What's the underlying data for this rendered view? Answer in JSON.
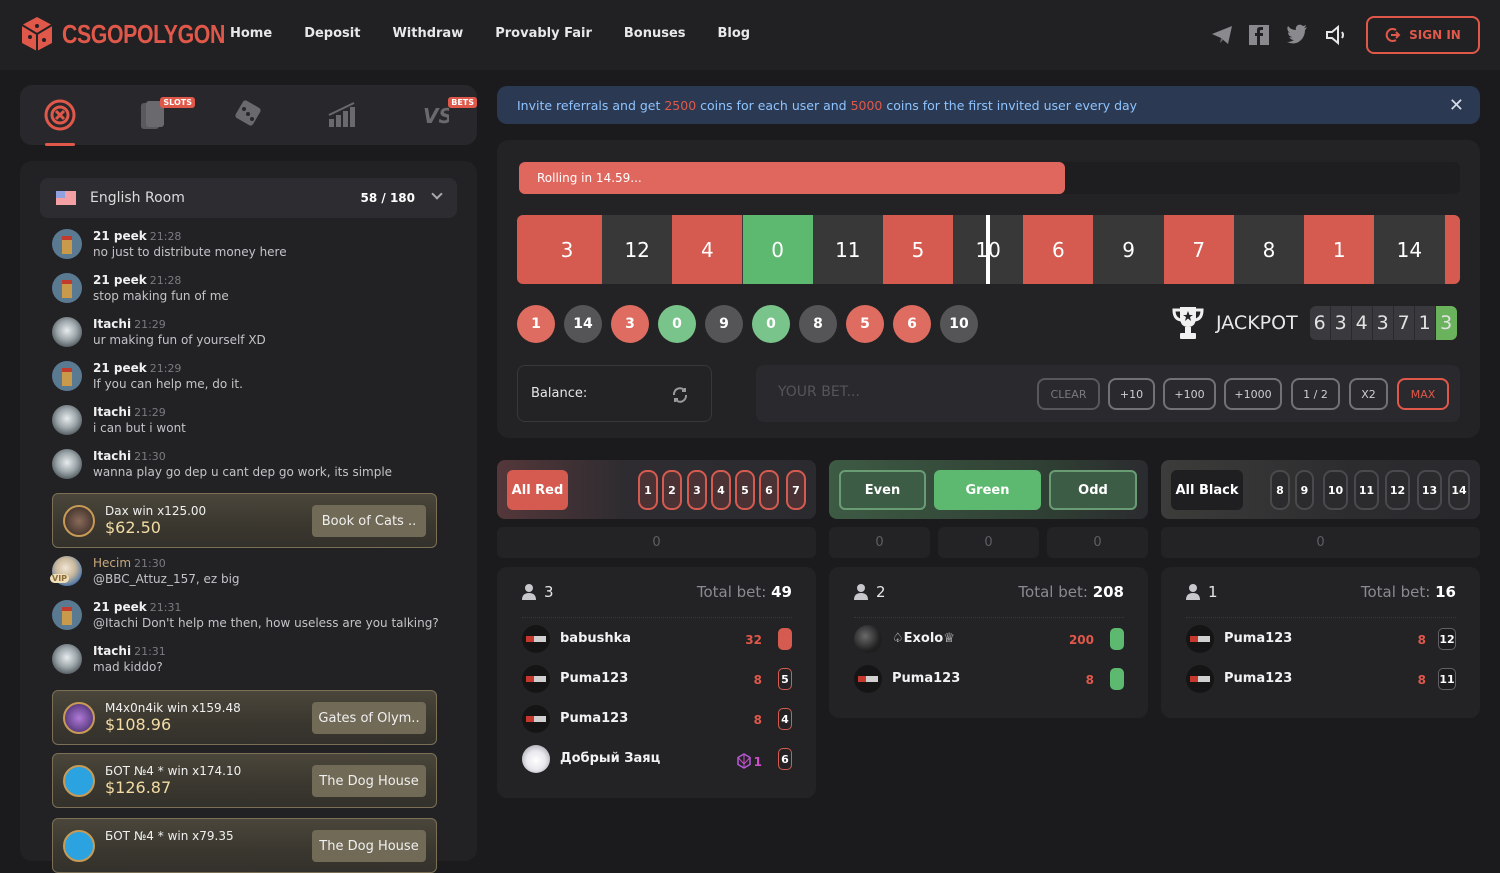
{
  "header": {
    "logo_text": "CSGOPOLYGON",
    "brand_color": "#e0584a",
    "nav": [
      "Home",
      "Deposit",
      "Withdraw",
      "Provably Fair",
      "Bonuses",
      "Blog"
    ],
    "social_icons": [
      "telegram-icon",
      "facebook-icon",
      "twitter-icon",
      "sound-icon"
    ],
    "signin_label": "SIGN IN"
  },
  "game_tabs": [
    {
      "name": "roulette",
      "icon": "roulette-icon",
      "active": true
    },
    {
      "name": "slots",
      "icon": "cards-icon",
      "badge": "SLOTS"
    },
    {
      "name": "dice",
      "icon": "dice-icon"
    },
    {
      "name": "crash",
      "icon": "chart-icon"
    },
    {
      "name": "versus",
      "icon": "vs-icon",
      "badge": "BETS"
    }
  ],
  "chat": {
    "room": "English Room",
    "online": "58 / 180",
    "items": [
      {
        "type": "msg",
        "user": "21 peek",
        "time": "21:28",
        "text": "no just to distribute money here",
        "avatar": "peek"
      },
      {
        "type": "msg",
        "user": "21 peek",
        "time": "21:28",
        "text": "stop making fun of me",
        "avatar": "peek"
      },
      {
        "type": "msg",
        "user": "Itachi",
        "time": "21:29",
        "text": "ur making fun of yourself XD",
        "avatar": "itachi"
      },
      {
        "type": "msg",
        "user": "21 peek",
        "time": "21:29",
        "text": "If you can help me, do it.",
        "avatar": "peek"
      },
      {
        "type": "msg",
        "user": "Itachi",
        "time": "21:29",
        "text": "i can but i wont",
        "avatar": "itachi"
      },
      {
        "type": "msg",
        "user": "Itachi",
        "time": "21:30",
        "text": "wanna play go dep u cant dep go work, its simple",
        "avatar": "itachi"
      },
      {
        "type": "win",
        "line1": "Dax win x125.00",
        "amount": "$62.50",
        "game": "Book of Cats .."
      },
      {
        "type": "msg",
        "user": "Hecim",
        "time": "21:30",
        "text": "@BBC_Attuz_157, ez big",
        "avatar": "hecim",
        "vip": "VIP"
      },
      {
        "type": "msg",
        "user": "21 peek",
        "time": "21:31",
        "text": "@Itachi Don't help me then, how useless are you talking?",
        "avatar": "peek"
      },
      {
        "type": "msg",
        "user": "Itachi",
        "time": "21:31",
        "text": "mad kiddo?",
        "avatar": "itachi"
      },
      {
        "type": "win",
        "line1": "M4x0n4ik win x159.48",
        "amount": "$108.96",
        "game": "Gates of Olym.."
      },
      {
        "type": "win",
        "line1": "БОТ №4 * win x174.10",
        "amount": "$126.87",
        "game": "The Dog House"
      },
      {
        "type": "win",
        "line1": "БОТ №4 * win x79.35",
        "amount": "",
        "game": "The Dog House"
      }
    ]
  },
  "banner": {
    "parts": [
      "Invite referrals and get ",
      "2500",
      " coins for each user and ",
      "5000",
      " coins for the first invited user every day"
    ]
  },
  "roulette": {
    "rolling_text": "Rolling in 14.59...",
    "rolling_progress": 0.58,
    "strip": [
      {
        "n": "3",
        "c": "red"
      },
      {
        "n": "12",
        "c": "black"
      },
      {
        "n": "4",
        "c": "red"
      },
      {
        "n": "0",
        "c": "green"
      },
      {
        "n": "11",
        "c": "black"
      },
      {
        "n": "5",
        "c": "red"
      },
      {
        "n": "10",
        "c": "black"
      },
      {
        "n": "6",
        "c": "red"
      },
      {
        "n": "9",
        "c": "black"
      },
      {
        "n": "7",
        "c": "red"
      },
      {
        "n": "8",
        "c": "black"
      },
      {
        "n": "1",
        "c": "red"
      },
      {
        "n": "14",
        "c": "black"
      }
    ],
    "history": [
      {
        "n": "1",
        "c": "red"
      },
      {
        "n": "14",
        "c": "black"
      },
      {
        "n": "3",
        "c": "red"
      },
      {
        "n": "0",
        "c": "green"
      },
      {
        "n": "9",
        "c": "black"
      },
      {
        "n": "0",
        "c": "green"
      },
      {
        "n": "8",
        "c": "black"
      },
      {
        "n": "5",
        "c": "red"
      },
      {
        "n": "6",
        "c": "red"
      },
      {
        "n": "10",
        "c": "black"
      }
    ],
    "jackpot_label": "JACKPOT",
    "jackpot_digits": [
      "6",
      "3",
      "4",
      "3",
      "7",
      "1",
      "3"
    ]
  },
  "bet": {
    "balance_label": "Balance:",
    "placeholder": "YOUR BET...",
    "buttons": [
      "CLEAR",
      "+10",
      "+100",
      "+1000",
      "1 / 2",
      "X2",
      "MAX"
    ]
  },
  "bet_options": {
    "red": {
      "label": "All Red",
      "numbers": [
        "1",
        "2",
        "3",
        "4",
        "5",
        "6",
        "7"
      ],
      "amount": "0"
    },
    "green": {
      "even": "Even",
      "green": "Green",
      "odd": "Odd",
      "amounts": [
        "0",
        "0",
        "0"
      ]
    },
    "black": {
      "label": "All Black",
      "numbers": [
        "8",
        "9",
        "10",
        "11",
        "12",
        "13",
        "14"
      ],
      "amount": "0"
    }
  },
  "bet_lists": [
    {
      "players": "3",
      "total_label": "Total bet:",
      "total": "49",
      "rows": [
        {
          "name": "babushka",
          "amount": "32",
          "tag": "",
          "tag_style": "redfull",
          "avatar": "csgo"
        },
        {
          "name": "Puma123",
          "amount": "8",
          "tag": "5",
          "tag_style": "redout",
          "avatar": "csgo"
        },
        {
          "name": "Puma123",
          "amount": "8",
          "tag": "4",
          "tag_style": "redout",
          "avatar": "csgo"
        },
        {
          "name": "Добрый Заяц",
          "amount": "1",
          "tag": "6",
          "tag_style": "redout",
          "avatar": "bunny",
          "coin": "gem"
        }
      ]
    },
    {
      "players": "2",
      "total_label": "Total bet:",
      "total": "208",
      "rows": [
        {
          "name": "♤Exolo♕",
          "amount": "200",
          "tag": "",
          "tag_style": "greenfull",
          "avatar": "exolo"
        },
        {
          "name": "Puma123",
          "amount": "8",
          "tag": "",
          "tag_style": "greenfull",
          "avatar": "csgo"
        }
      ]
    },
    {
      "players": "1",
      "total_label": "Total bet:",
      "total": "16",
      "rows": [
        {
          "name": "Puma123",
          "amount": "8",
          "tag": "12",
          "tag_style": "blkout",
          "avatar": "csgo"
        },
        {
          "name": "Puma123",
          "amount": "8",
          "tag": "11",
          "tag_style": "blkout",
          "avatar": "csgo"
        }
      ]
    }
  ]
}
